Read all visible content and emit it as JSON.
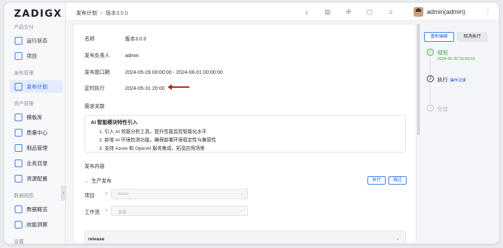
{
  "app": {
    "logo": "ZADIGX"
  },
  "sidebar": {
    "sections": [
      {
        "title": "产品交付",
        "items": [
          {
            "label": "运行状态",
            "icon": "monitor-icon"
          },
          {
            "label": "项目",
            "icon": "project-icon"
          }
        ]
      },
      {
        "title": "发布管理",
        "items": [
          {
            "label": "发布计划",
            "icon": "release-plan-icon",
            "active": true
          }
        ]
      },
      {
        "title": "资产管理",
        "items": [
          {
            "label": "模板库",
            "icon": "template-icon"
          },
          {
            "label": "质量中心",
            "icon": "quality-icon"
          },
          {
            "label": "制品管理",
            "icon": "artifact-icon"
          },
          {
            "label": "业务目录",
            "icon": "catalog-icon"
          },
          {
            "label": "资源配置",
            "icon": "resource-icon"
          }
        ]
      },
      {
        "title": "数据视图",
        "items": [
          {
            "label": "数据概览",
            "icon": "data-overview-icon"
          },
          {
            "label": "效能洞察",
            "icon": "insight-icon"
          }
        ]
      },
      {
        "title": "设置"
      }
    ]
  },
  "topbar": {
    "breadcrumb": [
      "发布计划",
      "版本3.0.0"
    ],
    "separator": ">",
    "user": "admin(admin)"
  },
  "plan": {
    "name_label": "名称",
    "name": "版本3.0.0",
    "owner_label": "发布负责人",
    "owner": "admin",
    "window_label": "发布窗口期",
    "window": "2024-05-29 00:00:00 - 2024-06-01 00:00:00",
    "schedule_label": "定时执行",
    "schedule": "2024-05-31 20:00"
  },
  "requirements": {
    "heading": "需求关联",
    "title": "AI 智能模块特性引入",
    "items": [
      "1. 引入 AI 效能分析工具，提升性能监控智能化水平",
      "2. 新增 AI 环境检测功能，确保部署环境稳定性与兼容性",
      "3. 支持 Azure 和 OpenAI 服务集成，拓宽应用场景"
    ]
  },
  "content": {
    "heading": "发布内容",
    "group": "生产发布",
    "run_label": "执行",
    "skip_label": "跳过",
    "project_label": "项目",
    "project_value": "demo",
    "workflow_label": "工作流",
    "workflow_value": "部署",
    "required_mark": "*",
    "release_title": "release"
  },
  "actions": {
    "edit": "重新编辑",
    "cancel": "取消执行"
  },
  "steps": [
    {
      "num": "✓",
      "title": "规划",
      "time": "2024-05-30 16:59:03",
      "state": "done"
    },
    {
      "num": "2",
      "title": "执行",
      "link": "操作记录",
      "state": "current"
    },
    {
      "num": "3",
      "title": "完成",
      "state": "pending"
    }
  ],
  "colors": {
    "accent": "#1e5fd8",
    "success": "#3aa33a",
    "annotation_arrow": "#b01d1d"
  }
}
